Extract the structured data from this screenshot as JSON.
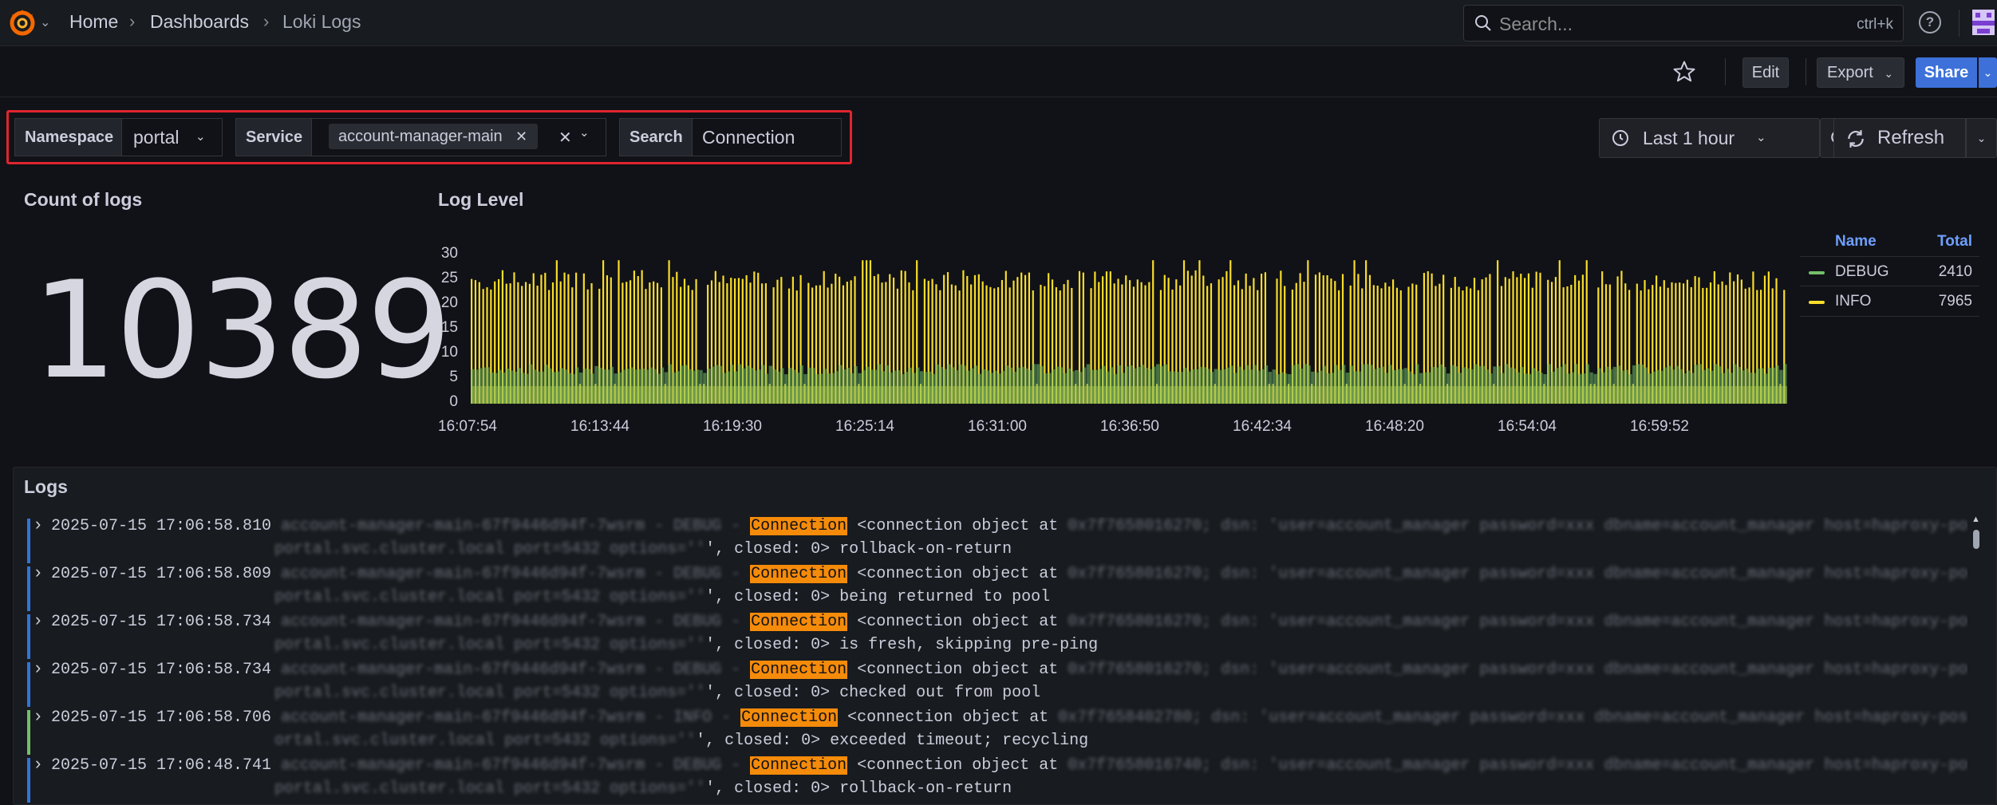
{
  "breadcrumb": {
    "items": [
      "Home",
      "Dashboards",
      "Loki Logs"
    ]
  },
  "search": {
    "placeholder": "Search...",
    "shortcut": "ctrl+k"
  },
  "toolbar": {
    "edit_label": "Edit",
    "export_label": "Export",
    "share_label": "Share"
  },
  "variables": {
    "namespace_label": "Namespace",
    "namespace_value": "portal",
    "service_label": "Service",
    "service_value": "account-manager-main",
    "search_label": "Search",
    "search_value": "Connection"
  },
  "time": {
    "range_label": "Last 1 hour",
    "refresh_label": "Refresh"
  },
  "count_panel": {
    "title": "Count of logs",
    "value": "10389"
  },
  "loglevel_panel": {
    "title": "Log Level",
    "legend_name_header": "Name",
    "legend_total_header": "Total",
    "legend": [
      {
        "name": "DEBUG",
        "total": "2410",
        "color": "#73bf69"
      },
      {
        "name": "INFO",
        "total": "7965",
        "color": "#fade2a"
      }
    ]
  },
  "chart_data": {
    "type": "bar",
    "title": "Log Level",
    "ylim": [
      0,
      30
    ],
    "yticks": [
      "30",
      "25",
      "20",
      "15",
      "10",
      "5",
      "0"
    ],
    "xticks": [
      "16:07:54",
      "16:13:44",
      "16:19:30",
      "16:25:14",
      "16:31:00",
      "16:36:50",
      "16:42:34",
      "16:48:20",
      "16:54:04",
      "16:59:52"
    ],
    "series": [
      {
        "name": "DEBUG",
        "color": "#73bf69",
        "typical_value": 7
      },
      {
        "name": "INFO",
        "color": "#fade2a",
        "typical_value": 26
      }
    ]
  },
  "logs_panel": {
    "title": "Logs",
    "entries": [
      {
        "ts": "2025-07-15 17:06:58.810",
        "level_color": "#3274d9",
        "blur1": "account-manager-main-67f9446d94f-7wsrm - DEBUG -",
        "match": "Connection",
        "rest1": " <connection object at ",
        "blur2": "0x7f7658016270; dsn: 'user=account_manager password=xxx dbname=account_manager host=haproxy-postgres.",
        "blur3": "portal.svc.cluster.local port=5432 options=''",
        "rest2": "', closed: 0> rollback-on-return"
      },
      {
        "ts": "2025-07-15 17:06:58.809",
        "level_color": "#3274d9",
        "blur1": "account-manager-main-67f9446d94f-7wsrm - DEBUG -",
        "match": "Connection",
        "rest1": " <connection object at ",
        "blur2": "0x7f7658016270; dsn: 'user=account_manager password=xxx dbname=account_manager host=haproxy-postgres.",
        "blur3": "portal.svc.cluster.local port=5432 options=''",
        "rest2": "', closed: 0> being returned to pool"
      },
      {
        "ts": "2025-07-15 17:06:58.734",
        "level_color": "#3274d9",
        "blur1": "account-manager-main-67f9446d94f-7wsrm - DEBUG -",
        "match": "Connection",
        "rest1": " <connection object at ",
        "blur2": "0x7f7658016270; dsn: 'user=account_manager password=xxx dbname=account_manager host=haproxy-postgres.",
        "blur3": "portal.svc.cluster.local port=5432 options=''",
        "rest2": "', closed: 0> is fresh, skipping pre-ping"
      },
      {
        "ts": "2025-07-15 17:06:58.734",
        "level_color": "#3274d9",
        "blur1": "account-manager-main-67f9446d94f-7wsrm - DEBUG -",
        "match": "Connection",
        "rest1": " <connection object at ",
        "blur2": "0x7f7658016270; dsn: 'user=account_manager password=xxx dbname=account_manager host=haproxy-postgres.",
        "blur3": "portal.svc.cluster.local port=5432 options=''",
        "rest2": "', closed: 0> checked out from pool"
      },
      {
        "ts": "2025-07-15 17:06:58.706",
        "level_color": "#73bf69",
        "blur1": "account-manager-main-67f9446d94f-7wsrm - INFO -",
        "match": "Connection",
        "rest1": " <connection object at ",
        "blur2": "0x7f7658402780; dsn: 'user=account_manager password=xxx dbname=account_manager host=haproxy-postgres.p",
        "blur3": "ortal.svc.cluster.local port=5432 options=''",
        "rest2": "', closed: 0> exceeded timeout; recycling"
      },
      {
        "ts": "2025-07-15 17:06:48.741",
        "level_color": "#3274d9",
        "blur1": "account-manager-main-67f9446d94f-7wsrm - DEBUG -",
        "match": "Connection",
        "rest1": " <connection object at ",
        "blur2": "0x7f7658016740; dsn: 'user=account_manager password=xxx dbname=account_manager host=haproxy-postgres.",
        "blur3": "portal.svc.cluster.local port=5432 options=''",
        "rest2": "', closed: 0> rollback-on-return"
      }
    ]
  },
  "icons": {
    "logo": "grafana-logo-icon",
    "search": "search-icon",
    "help": "help-icon",
    "star": "star-icon",
    "clock": "clock-icon",
    "zoom_out": "zoom-out-icon",
    "refresh": "refresh-icon"
  }
}
